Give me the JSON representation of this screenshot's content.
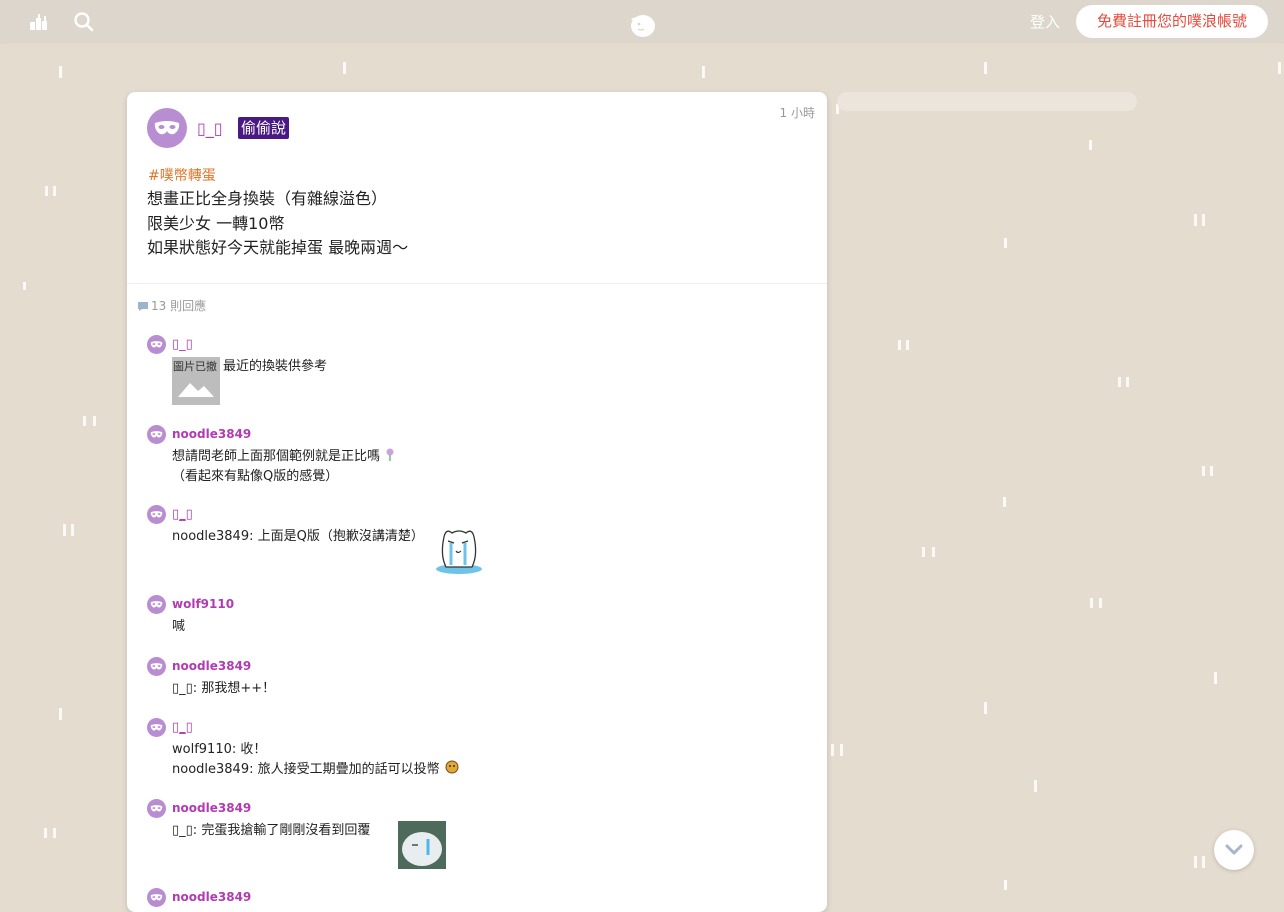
{
  "topbar": {
    "left_icon_1": "skyline-icon",
    "left_icon_2": "search-icon",
    "logo": "plurk-logo-icon",
    "login_label": "登入",
    "register_label": "免費註冊您的噗浪帳號"
  },
  "post": {
    "author": "▯_▯",
    "secret_tag": "偷偷說",
    "time": "1 小時",
    "hashtag": "#噗幣轉蛋",
    "lines": [
      "想畫正比全身換裝（有雜線溢色）",
      "限美少女 一轉10幣",
      "如果狀態好今天就能掉蛋 最晚兩週〜"
    ],
    "reply_count": "13 則回應"
  },
  "replies": [
    {
      "name": "▯_▯",
      "image_alt": "圖片已撤",
      "text": "最近的換裝供參考"
    },
    {
      "name": "noodle3849",
      "line1": "想請問老師上面那個範例就是正比嗎",
      "line2": "（看起來有點像Q版的感覺）"
    },
    {
      "name": "▯_▯",
      "text": "noodle3849: 上面是Q版（抱歉沒講清楚）"
    },
    {
      "name": "wolf9110",
      "text": "喊"
    },
    {
      "name": "noodle3849",
      "text": "▯_▯: 那我想++！"
    },
    {
      "name": "▯_▯",
      "line1": "wolf9110: 收！",
      "line2": "noodle3849: 旅人接受工期疊加的話可以投幣"
    },
    {
      "name": "noodle3849",
      "text": "▯_▯: 完蛋我搶輸了剛剛沒看到回覆"
    },
    {
      "name": "noodle3849"
    }
  ],
  "colors": {
    "background": "#e4dccf",
    "author": "#b23bb3",
    "secret_tag_bg": "#4a1a83",
    "hashtag": "#e1762b",
    "register_text": "#e84b3d"
  }
}
